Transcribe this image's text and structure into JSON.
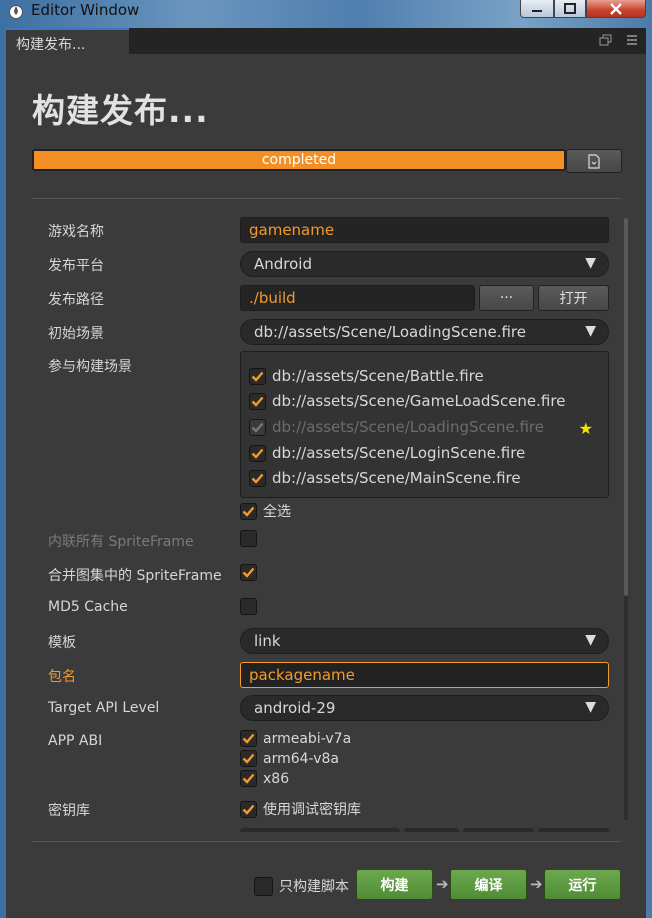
{
  "window": {
    "title": "Editor Window",
    "controls": {
      "minimize": "minimize-icon",
      "maximize": "maximize-icon",
      "close": "close-icon"
    }
  },
  "tab": {
    "label": "构建发布..."
  },
  "tab_icons": [
    "restore-window-icon",
    "menu-icon"
  ],
  "heading": "构建发布...",
  "progress": {
    "text": "completed",
    "percent": 100
  },
  "form": {
    "game_name": {
      "label": "游戏名称",
      "value": "gamename"
    },
    "platform": {
      "label": "发布平台",
      "value": "Android"
    },
    "build_path": {
      "label": "发布路径",
      "value": "./build",
      "browse_label": "···",
      "open_label": "打开"
    },
    "start_scene": {
      "label": "初始场景",
      "value": "db://assets/Scene/LoadingScene.fire"
    },
    "build_scenes": {
      "label": "参与构建场景",
      "items": [
        {
          "path": "db://assets/Scene/Battle.fire",
          "checked": true,
          "disabled": false
        },
        {
          "path": "db://assets/Scene/GameLoadScene.fire",
          "checked": true,
          "disabled": false
        },
        {
          "path": "db://assets/Scene/LoadingScene.fire",
          "checked": true,
          "disabled": true,
          "start": true
        },
        {
          "path": "db://assets/Scene/LoginScene.fire",
          "checked": true,
          "disabled": false
        },
        {
          "path": "db://assets/Scene/MainScene.fire",
          "checked": true,
          "disabled": false
        }
      ],
      "select_all_label": "全选"
    },
    "inline_spriteframes": {
      "label": "内联所有 SpriteFrame",
      "checked": false
    },
    "merge_spriteframes": {
      "label": "合并图集中的 SpriteFrame",
      "checked": true
    },
    "md5_cache": {
      "label": "MD5 Cache",
      "checked": false
    },
    "template": {
      "label": "模板",
      "value": "link"
    },
    "package_name": {
      "label": "包名",
      "value": "packagename"
    },
    "api_level": {
      "label": "Target API Level",
      "value": "android-29"
    },
    "app_abi": {
      "label": "APP ABI",
      "options": [
        {
          "name": "armeabi-v7a",
          "checked": true
        },
        {
          "name": "arm64-v8a",
          "checked": true
        },
        {
          "name": "x86",
          "checked": true
        }
      ]
    },
    "keystore": {
      "label": "密钥库",
      "option_label": "使用调试密钥库",
      "checked": true
    }
  },
  "footer": {
    "script_only_label": "只构建脚本",
    "build_label": "构建",
    "compile_label": "编译",
    "run_label": "运行"
  },
  "colors": {
    "accent": "#f39a2c",
    "panel": "#3b3b3b",
    "green": "#5c9a3f"
  }
}
